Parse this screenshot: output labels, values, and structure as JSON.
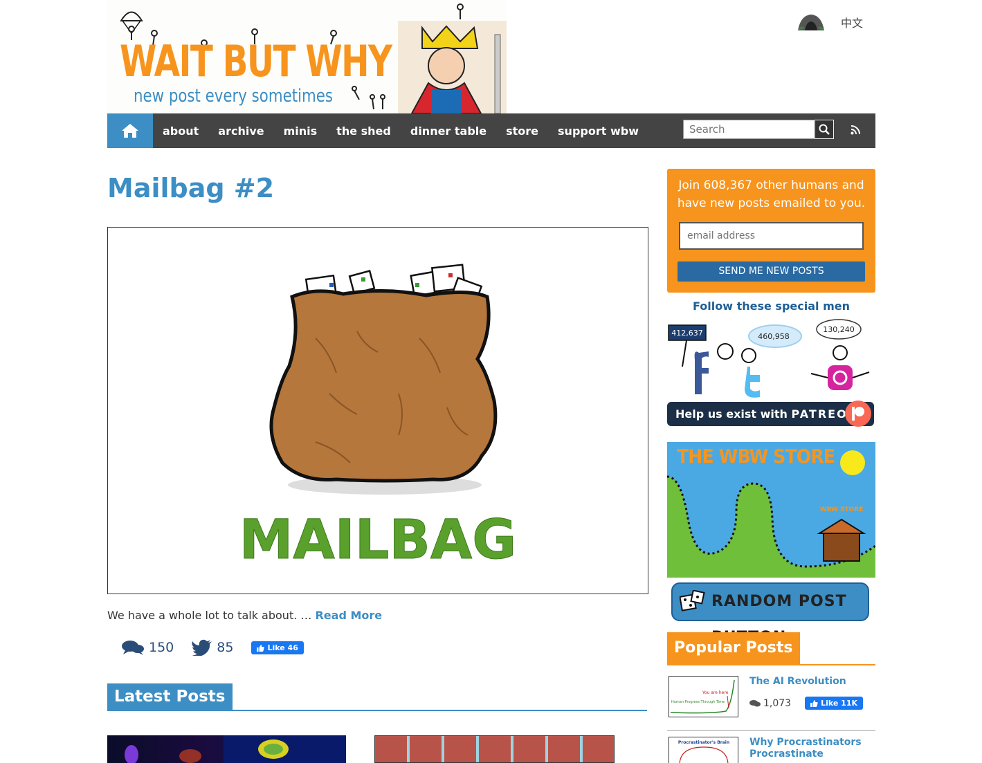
{
  "header": {
    "logo_title": "WAIT BUT WHY",
    "logo_tagline": "new post every sometimes",
    "lang_label": "中文"
  },
  "nav": {
    "items": [
      "about",
      "archive",
      "minis",
      "the shed",
      "dinner table",
      "store",
      "support wbw"
    ],
    "search_placeholder": "Search"
  },
  "post": {
    "title": "Mailbag #2",
    "image_caption": "MAILBAG",
    "excerpt": "We have a whole lot to talk about. …",
    "read_more": "Read More",
    "comments": "150",
    "tweets": "85",
    "fb_like": "Like 46"
  },
  "latest": {
    "heading": "Latest Posts"
  },
  "sidebar": {
    "signup_text": "Join 608,367 other humans and have new posts emailed to you.",
    "email_placeholder": "email address",
    "signup_button": "SEND ME NEW POSTS",
    "follow_heading": "Follow these special men",
    "facebook_count": "412,637",
    "twitter_count": "460,958",
    "instagram_count": "130,240",
    "patreon_text": "Help us exist with",
    "patreon_brand": "PATREON",
    "store_title": "THE WBW STORE",
    "store_sign": "WBW STORE",
    "random_button": "RANDOM POST BUTTON",
    "popular_heading": "Popular Posts",
    "popular": [
      {
        "title": "The AI Revolution",
        "comments": "1,073",
        "fb_like": "Like 11K",
        "thumb_text_a": "You are here",
        "thumb_text_b": "Human Progress Through Time"
      },
      {
        "title": "Why Procrastinators Procrastinate",
        "thumb_text": "Procrastinator's Brain"
      }
    ]
  },
  "colors": {
    "brand_orange": "#f7941d",
    "brand_blue": "#3c8ec4",
    "nav_bg": "#444444"
  }
}
